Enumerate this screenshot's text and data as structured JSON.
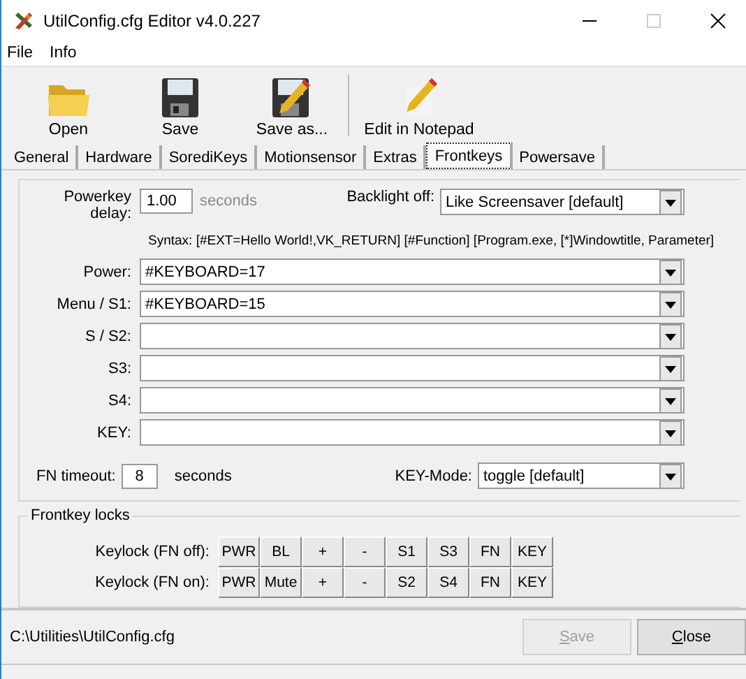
{
  "window": {
    "title": "UtilConfig.cfg Editor v4.0.227"
  },
  "menu": [
    {
      "label": "File"
    },
    {
      "label": "Info"
    }
  ],
  "toolbar": [
    {
      "label": "Open",
      "kind": "open"
    },
    {
      "label": "Save",
      "kind": "save"
    },
    {
      "label": "Save as...",
      "kind": "saveas"
    },
    {
      "label": "Edit in Notepad",
      "kind": "notepad"
    }
  ],
  "tabs": [
    {
      "label": "General",
      "selected": false
    },
    {
      "label": "Hardware",
      "selected": false
    },
    {
      "label": "SorediKeys",
      "selected": false
    },
    {
      "label": "Motionsensor",
      "selected": false
    },
    {
      "label": "Extras",
      "selected": false
    },
    {
      "label": "Frontkeys",
      "selected": true
    },
    {
      "label": "Powersave",
      "selected": false
    }
  ],
  "powerkey": {
    "label": "Powerkey delay:",
    "value": "1.00",
    "unit": "seconds",
    "unit_disabled": true
  },
  "backlight": {
    "label": "Backlight off:",
    "value": "Like Screensaver [default]"
  },
  "syntax": "Syntax: [#EXT=Hello World!,VK_RETURN] [#Function] [Program.exe, [*]Windowtitle, Parameter]",
  "keys": [
    {
      "label": "Power:",
      "value": "#KEYBOARD=17"
    },
    {
      "label": "Menu / S1:",
      "value": "#KEYBOARD=15"
    },
    {
      "label": "S / S2:"
    },
    {
      "label": "S3:"
    },
    {
      "label": "S4:"
    },
    {
      "label": "KEY:"
    }
  ],
  "fn_timeout": {
    "label": "FN timeout:",
    "value": "8",
    "unit": "seconds"
  },
  "key_mode": {
    "label": "KEY-Mode:",
    "value": "toggle [default]"
  },
  "locks": {
    "title": "Frontkey locks",
    "rows": [
      {
        "label": "Keylock (FN off):",
        "keys": [
          "PWR",
          "BL",
          "+",
          "-",
          "S1",
          "S3",
          "FN",
          "KEY"
        ]
      },
      {
        "label": "Keylock (FN on):",
        "keys": [
          "PWR",
          "Mute",
          "+",
          "-",
          "S2",
          "S4",
          "FN",
          "KEY"
        ]
      }
    ]
  },
  "footer": {
    "path": "C:\\Utilities\\UtilConfig.cfg",
    "buttons": [
      {
        "label": "Save",
        "disabled": true
      },
      {
        "label": "Close",
        "disabled": false
      }
    ]
  }
}
